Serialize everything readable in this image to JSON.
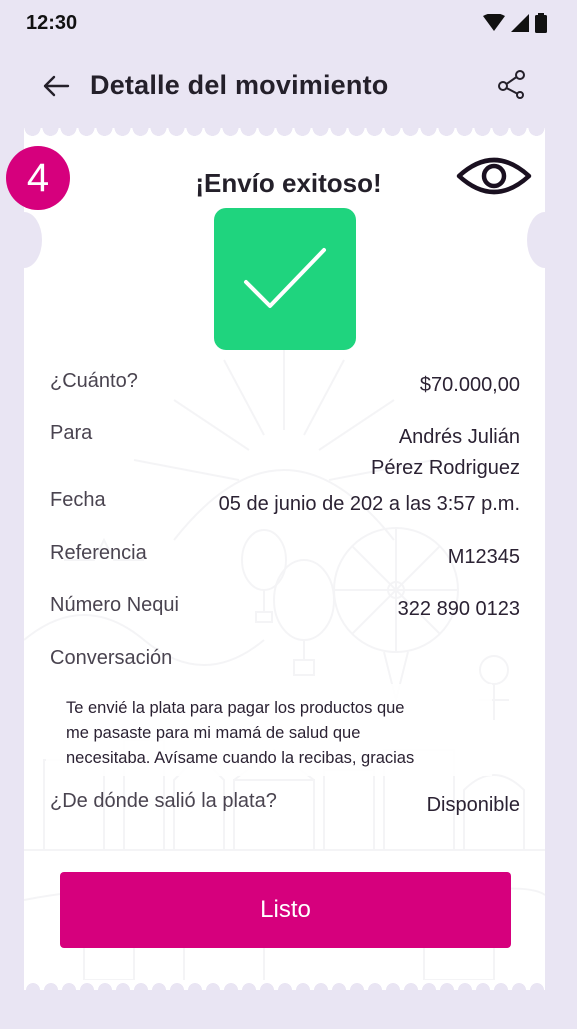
{
  "status_bar": {
    "time": "12:30"
  },
  "header": {
    "title": "Detalle del movimiento"
  },
  "step_badge": "4",
  "success_title": "¡Envío exitoso!",
  "details": {
    "amount": {
      "label": "¿Cuánto?",
      "value": "$70.000,00"
    },
    "to": {
      "label": "Para",
      "value_line1": "Andrés Julián",
      "value_line2": "Pérez Rodriguez"
    },
    "date": {
      "label": "Fecha",
      "value": "05 de junio de 202 a las 3:57 p.m."
    },
    "reference": {
      "label": "Referencia",
      "value": "M12345"
    },
    "nequi_number": {
      "label": "Número Nequi",
      "value": "322 890 0123"
    },
    "conversation": {
      "label": "Conversación",
      "line1": "Te envié la plata para pagar los productos que",
      "line2": "me pasaste para mi mamá de salud que",
      "line3": "necesitaba. Avísame cuando la recibas, gracias"
    },
    "source": {
      "label": "¿De dónde salió la plata?",
      "value": "Disponible"
    }
  },
  "done_button": "Listo",
  "colors": {
    "accent": "#d6007d",
    "success": "#1fd47e",
    "background": "#e9e5f3"
  },
  "icons": [
    "back-arrow-icon",
    "share-icon",
    "eye-icon",
    "checkmark-icon",
    "wifi-icon",
    "signal-icon",
    "battery-icon"
  ]
}
